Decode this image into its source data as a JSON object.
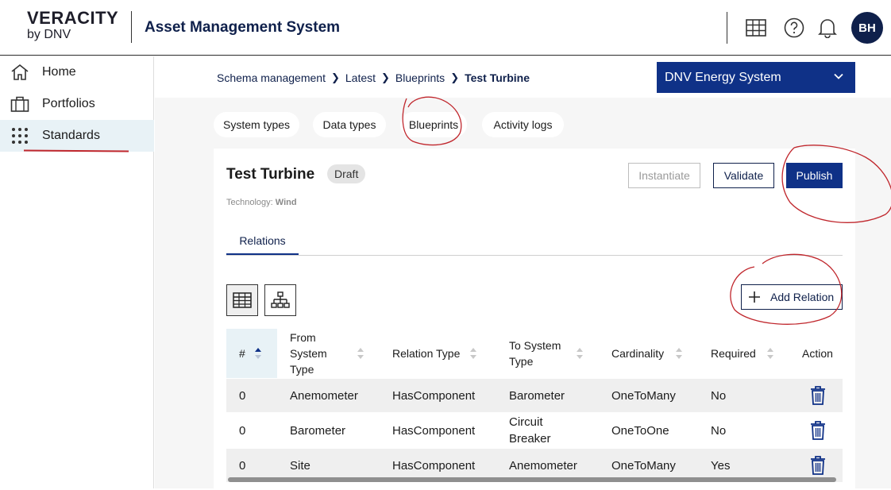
{
  "header": {
    "logo_line1": "VERACITY",
    "logo_line2": "by DNV",
    "app_title": "Asset Management System",
    "avatar_initials": "BH",
    "icons": [
      "apps-grid-icon",
      "help-icon",
      "bell-icon"
    ]
  },
  "sidebar": {
    "items": [
      {
        "label": "Home",
        "icon": "home-icon"
      },
      {
        "label": "Portfolios",
        "icon": "briefcase-icon"
      },
      {
        "label": "Standards",
        "icon": "dots-grid-icon",
        "active": true
      }
    ]
  },
  "breadcrumb": {
    "items": [
      "Schema management",
      "Latest",
      "Blueprints",
      "Test Turbine"
    ]
  },
  "system_select": {
    "value": "DNV Energy System"
  },
  "nav_tabs": [
    "System types",
    "Data types",
    "Blueprints",
    "Activity logs"
  ],
  "blueprint": {
    "title": "Test Turbine",
    "status": "Draft",
    "technology_label": "Technology:",
    "technology_value": "Wind",
    "actions": {
      "instantiate": "Instantiate",
      "validate": "Validate",
      "publish": "Publish"
    },
    "section_tab": "Relations",
    "add_relation": "Add Relation"
  },
  "table": {
    "columns": {
      "index": "#",
      "from": "From System Type",
      "relation": "Relation Type",
      "to": "To System Type",
      "cardinality": "Cardinality",
      "required": "Required",
      "action": "Action"
    },
    "rows": [
      {
        "index": "0",
        "from": "Anemometer",
        "relation": "HasComponent",
        "to": "Barometer",
        "cardinality": "OneToMany",
        "required": "No"
      },
      {
        "index": "0",
        "from": "Barometer",
        "relation": "HasComponent",
        "to": "Circuit Breaker",
        "cardinality": "OneToOne",
        "required": "No"
      },
      {
        "index": "0",
        "from": "Site",
        "relation": "HasComponent",
        "to": "Anemometer",
        "cardinality": "OneToMany",
        "required": "Yes"
      }
    ]
  },
  "colors": {
    "brand_navy": "#0f204b",
    "primary_blue": "#0f3187",
    "annotation_red": "#c0272d"
  }
}
